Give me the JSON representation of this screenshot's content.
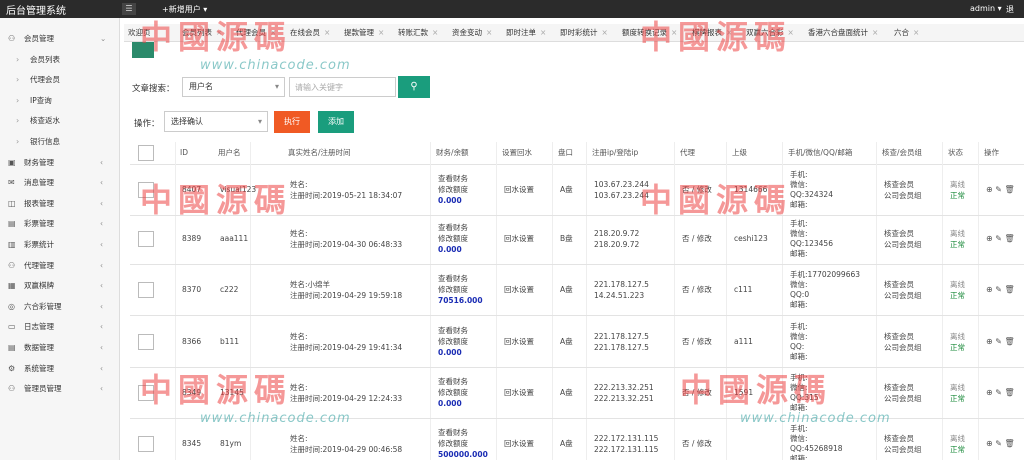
{
  "app": {
    "title": "后台管理系统",
    "new_user": "+新增用户 ▾",
    "admin": "admin ▾",
    "logout": "退"
  },
  "sidebar": {
    "items": [
      {
        "label": "会员管理",
        "icon": "user-icon",
        "sub": false,
        "open": true
      },
      {
        "label": "会员列表",
        "sub": true
      },
      {
        "label": "代理会员",
        "sub": true
      },
      {
        "label": "IP查询",
        "sub": true
      },
      {
        "label": "核查返水",
        "sub": true
      },
      {
        "label": "银行信息",
        "sub": true
      },
      {
        "label": "财务管理",
        "icon": "wallet-icon",
        "sub": false
      },
      {
        "label": "消息管理",
        "icon": "message-icon",
        "sub": false
      },
      {
        "label": "报表管理",
        "icon": "report-icon",
        "sub": false
      },
      {
        "label": "彩票管理",
        "icon": "ticket-icon",
        "sub": false
      },
      {
        "label": "彩票统计",
        "icon": "chart-icon",
        "sub": false
      },
      {
        "label": "代理管理",
        "icon": "agent-icon",
        "sub": false
      },
      {
        "label": "双赢棋牌",
        "icon": "cards-icon",
        "sub": false
      },
      {
        "label": "六合彩管理",
        "icon": "lottery-icon",
        "sub": false
      },
      {
        "label": "日志管理",
        "icon": "log-icon",
        "sub": false
      },
      {
        "label": "数据管理",
        "icon": "data-icon",
        "sub": false
      },
      {
        "label": "系统管理",
        "icon": "gear-icon",
        "sub": false
      },
      {
        "label": "管理员管理",
        "icon": "admin-icon",
        "sub": false
      }
    ]
  },
  "tabs": [
    "欢迎页",
    "会员列表",
    "代理会员",
    "在线会员",
    "提款管理",
    "转账汇款",
    "资金变动",
    "即时注单",
    "即时彩统计",
    "额度转换记录",
    "棋牌报表",
    "双赢六合彩",
    "香港六合盘面统计",
    "六合"
  ],
  "search": {
    "label": "文章搜索：",
    "field": "用户名",
    "placeholder": "请输入关键字",
    "button_icon": "search-icon"
  },
  "ops": {
    "label": "操作：",
    "select": "选择确认",
    "exec": "执行",
    "add": "添加"
  },
  "columns": [
    "ID",
    "用户名",
    "真实姓名/注册时间",
    "财务/余额",
    "设置回水",
    "盘口",
    "注册ip/登陆ip",
    "代理",
    "上级",
    "手机/微信/QQ/邮箱",
    "核查/会员组",
    "状态",
    "操作"
  ],
  "rows": [
    {
      "id": "8407",
      "username": "visual123",
      "name": "姓名:",
      "regtime": "注册时间:2019-05-21 18:34:07",
      "fin1": "查看财务",
      "fin2": "修改额度",
      "balance": "0.000",
      "rebate": "回水设置",
      "pan": "A盘",
      "ip1": "103.67.23.244",
      "ip2": "103.67.23.244",
      "agent": "否 / 修改",
      "parent": "1314666",
      "phone": "手机:",
      "wechat": "微信:",
      "qq": "QQ:324324",
      "email": "邮箱:",
      "grp1": "核查会员",
      "grp2": "公司会员组",
      "st1": "离线",
      "st2": "正常"
    },
    {
      "id": "8389",
      "username": "aaa111",
      "name": "姓名:",
      "regtime": "注册时间:2019-04-30 06:48:33",
      "fin1": "查看财务",
      "fin2": "修改额度",
      "balance": "0.000",
      "rebate": "回水设置",
      "pan": "B盘",
      "ip1": "218.20.9.72",
      "ip2": "218.20.9.72",
      "agent": "否 / 修改",
      "parent": "ceshi123",
      "phone": "手机:",
      "wechat": "微信:",
      "qq": "QQ:123456",
      "email": "邮箱:",
      "grp1": "核查会员",
      "grp2": "公司会员组",
      "st1": "离线",
      "st2": "正常"
    },
    {
      "id": "8370",
      "username": "c222",
      "name": "姓名:小绵羊",
      "regtime": "注册时间:2019-04-29 19:59:18",
      "fin1": "查看财务",
      "fin2": "修改额度",
      "balance": "70516.000",
      "rebate": "回水设置",
      "pan": "A盘",
      "ip1": "221.178.127.5",
      "ip2": "14.24.51.223",
      "agent": "否 / 修改",
      "parent": "c111",
      "phone": "手机:17702099663",
      "wechat": "微信:",
      "qq": "QQ:0",
      "email": "邮箱:",
      "grp1": "核查会员",
      "grp2": "公司会员组",
      "st1": "离线",
      "st2": "正常"
    },
    {
      "id": "8366",
      "username": "b111",
      "name": "姓名:",
      "regtime": "注册时间:2019-04-29 19:41:34",
      "fin1": "查看财务",
      "fin2": "修改额度",
      "balance": "0.000",
      "rebate": "回水设置",
      "pan": "A盘",
      "ip1": "221.178.127.5",
      "ip2": "221.178.127.5",
      "agent": "否 / 修改",
      "parent": "a111",
      "phone": "手机:",
      "wechat": "微信:",
      "qq": "QQ:",
      "email": "邮箱:",
      "grp1": "核查会员",
      "grp2": "公司会员组",
      "st1": "离线",
      "st2": "正常"
    },
    {
      "id": "8349",
      "username": "13145",
      "name": "姓名:",
      "regtime": "注册时间:2019-04-29 12:24:33",
      "fin1": "查看财务",
      "fin2": "修改额度",
      "balance": "0.000",
      "rebate": "回水设置",
      "pan": "A盘",
      "ip1": "222.213.32.251",
      "ip2": "222.213.32.251",
      "agent": "否 / 修改",
      "parent": "1591",
      "phone": "手机:",
      "wechat": "微信:",
      "qq": "QQ:315",
      "email": "邮箱:",
      "grp1": "核查会员",
      "grp2": "公司会员组",
      "st1": "离线",
      "st2": "正常"
    },
    {
      "id": "8345",
      "username": "81ym",
      "name": "姓名:",
      "regtime": "注册时间:2019-04-29 00:46:58",
      "fin1": "查看财务",
      "fin2": "修改额度",
      "balance": "500000.000",
      "rebate": "回水设置",
      "pan": "A盘",
      "ip1": "222.172.131.115",
      "ip2": "222.172.131.115",
      "agent": "否 / 修改",
      "parent": "",
      "phone": "手机:",
      "wechat": "微信:",
      "qq": "QQ:45268918",
      "email": "邮箱:",
      "grp1": "核查会员",
      "grp2": "公司会员组",
      "st1": "离线",
      "st2": "正常"
    }
  ],
  "watermark": {
    "chars": "中國源碼",
    "url": "www.chinacode.com"
  },
  "colors": {
    "topbar": "#2b2b2b",
    "accent_green": "#1a9d7d",
    "exec_orange": "#f05a24",
    "balance_blue": "#1b2db4"
  }
}
